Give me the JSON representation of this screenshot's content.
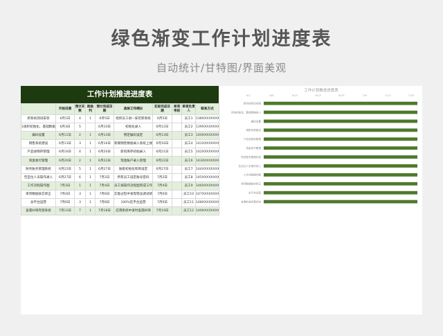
{
  "header": {
    "title": "绿色渐变工作计划进度表",
    "subtitle": "自动统计/甘特图/界面美观"
  },
  "table": {
    "title": "工作计划推进进度表",
    "columns": [
      "",
      "开始日期",
      "预计天数",
      "耗助判",
      "预计完成日期",
      "具体工作细分",
      "实际完成日期",
      "单项考核",
      "单项负责人",
      "联系方式"
    ],
    "rows": [
      [
        "新系统测试安装",
        "6月1日",
        "4",
        "1",
        "6月5日",
        "组织员工进一安装新系统",
        "6月5日",
        "",
        "员工1",
        "138XXXXXXXX"
      ],
      [
        "1组织初始化、基础数据录入",
        "6月3日",
        "5",
        "",
        "6月10日",
        "初始化录入",
        "6月12日",
        "",
        "员工2",
        "139XXXXXXXX"
      ],
      [
        "编码设置",
        "6月11日",
        "2",
        "1",
        "6月13日",
        "物定编码设定",
        "6月13日",
        "",
        "员工3",
        "140XXXXXXXX"
      ],
      [
        "销售系统建设",
        "6月13日",
        "3",
        "1",
        "6月16日",
        "新期销售数据录入系统上线",
        "6月16日",
        "",
        "员工4",
        "141XXXXXXXX"
      ],
      [
        "产品进销存管理",
        "6月16日",
        "4",
        "1",
        "6月20日",
        "新初库存初始录入",
        "6月21日",
        "",
        "员工5",
        "142XXXXXXXX"
      ],
      [
        "资金收付管理",
        "6月20日",
        "2",
        "1",
        "6月22日",
        "现金账户录入管理",
        "6月22日",
        "",
        "员工6",
        "143XXXXXXXX"
      ],
      [
        "财务账务管理系统",
        "6月22日",
        "5",
        "1",
        "6月27日",
        "账套初始化和目设定",
        "6月27日",
        "",
        "员工7",
        "144XXXXXXXX"
      ],
      [
        "告自位人员操作录入",
        "6月27日",
        "6",
        "1",
        "7月2日",
        "所有员工设定账号密码",
        "7月2日",
        "",
        "员工8",
        "145XXXXXXXX"
      ],
      [
        "工作流程操作图",
        "7月3日",
        "1",
        "1",
        "7月4日",
        "员工按操作流程图完成工作内容",
        "7月4日",
        "",
        "员工9",
        "146XXXXXXXX"
      ],
      [
        "单项数据核实修正",
        "7月4日",
        "3",
        "1",
        "7月6日",
        "实能过检中发现错误调试修正",
        "7月6日",
        "",
        "员工10",
        "147XXXXXXXX"
      ],
      [
        "总平台运营",
        "7月6日",
        "3",
        "1",
        "7月8日",
        "100%在平台运营",
        "7月9日",
        "",
        "员工11",
        "148XXXXXXXX"
      ],
      [
        "查漏补缺完善系统",
        "7月12日",
        "7",
        "1",
        "7月18日",
        "应用系统中发时查漏补缺",
        "7月19日",
        "",
        "员工12",
        "149XXXXXXXX"
      ]
    ]
  },
  "chart_data": {
    "type": "bar",
    "title": "工作计划推进进度表",
    "x_ticks": [
      "6/1",
      "6/8",
      "6/15",
      "6/22",
      "6/29",
      "7/6",
      "7/13",
      "7/20"
    ],
    "categories": [
      "新系统测试安装",
      "系统初始化、基础数据录入",
      "编码设置",
      "销售系统建设",
      "产品进销存管理",
      "资金收付管理",
      "财务账务管理系统",
      "告自位人员操作录入",
      "工作流程操作图",
      "单项数据核实修正",
      "总平台运营",
      "查漏补缺完善系统"
    ],
    "values": [
      51,
      51,
      51,
      51,
      51,
      51,
      51,
      51,
      51,
      51,
      51,
      51
    ],
    "xlim": [
      0,
      51
    ],
    "bar_color": "#4e7a2c"
  },
  "colors": {
    "header_dark": "#1e3a10",
    "row_highlight": "#e3efdc",
    "bar": "#4e7a2c"
  }
}
